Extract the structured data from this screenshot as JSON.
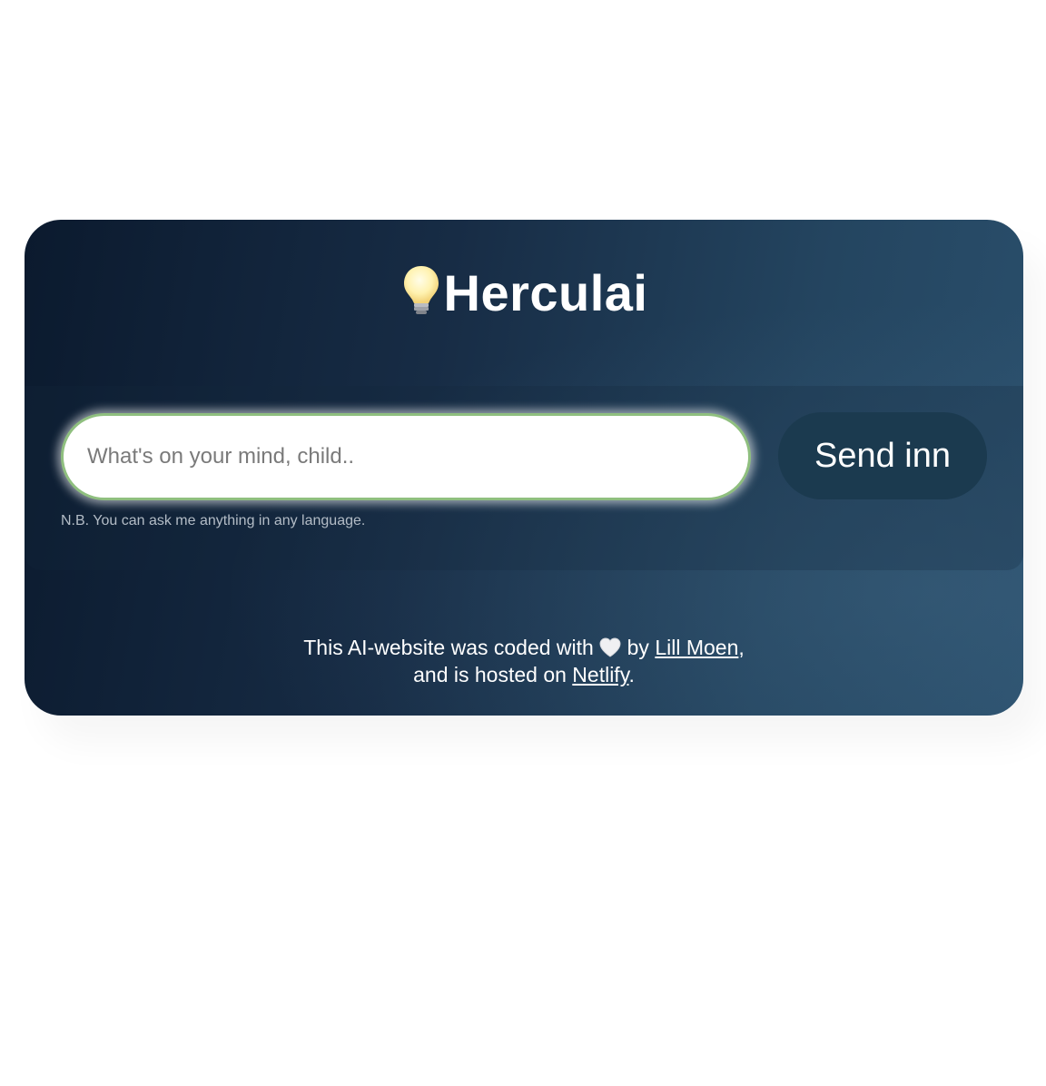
{
  "header": {
    "title": "Herculai",
    "icon": "lightbulb-icon"
  },
  "search": {
    "placeholder": "What's on your mind, child..",
    "value": ""
  },
  "send_button": {
    "label": "Send inn"
  },
  "hint": {
    "text": "N.B. You can ask me anything in any language."
  },
  "footer": {
    "line1_prefix": "This AI-website was coded with",
    "heart_icon": "heart-icon",
    "line1_by": "by",
    "author_link": "Lill Moen",
    "line1_suffix": ",",
    "line2_prefix": "and is hosted on",
    "host_link": "Netlify",
    "line2_suffix": "."
  },
  "colors": {
    "card_dark": "#0b1a2e",
    "card_light": "#2a4f6c",
    "input_border": "#8fbf7f",
    "button_bg": "#1b3a4f"
  }
}
